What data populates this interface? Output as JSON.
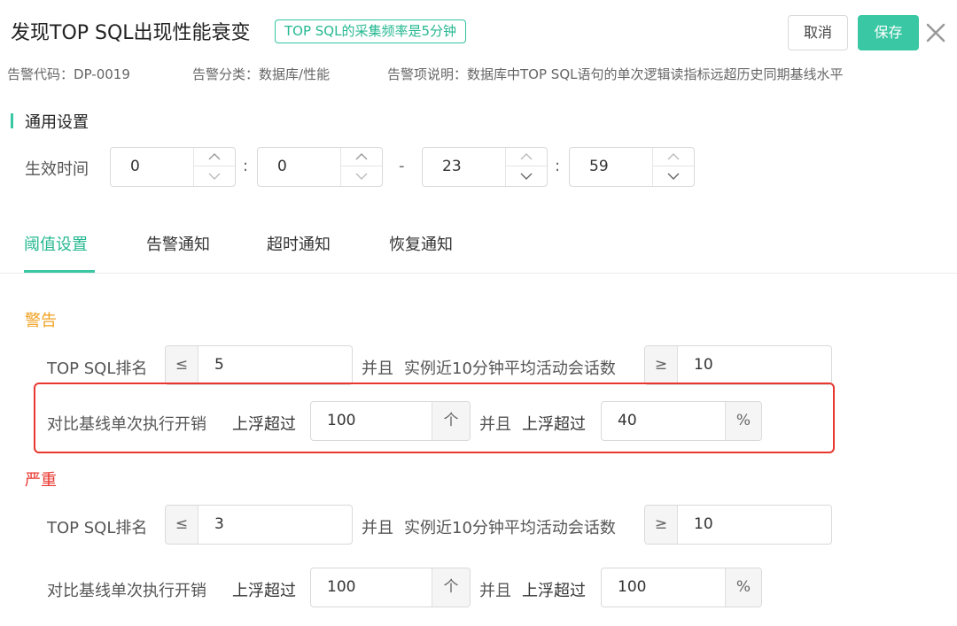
{
  "header": {
    "title": "发现TOP SQL出现性能衰变",
    "badge": "TOP SQL的采集频率是5分钟",
    "cancel_label": "取消",
    "save_label": "保存"
  },
  "meta": {
    "code_label": "告警代码：",
    "code": "DP-0019",
    "category_label": "告警分类：",
    "category": "数据库/性能",
    "desc_label": "告警项说明：",
    "desc": "数据库中TOP SQL语句的单次逻辑读指标远超历史同期基线水平"
  },
  "general": {
    "section_title": "通用设置",
    "effective_time_label": "生效时间",
    "start_hour": "0",
    "start_minute": "0",
    "end_hour": "23",
    "end_minute": "59",
    "colon": ":",
    "dash": "-"
  },
  "tabs": [
    {
      "label": "阈值设置",
      "active": true
    },
    {
      "label": "告警通知",
      "active": false
    },
    {
      "label": "超时通知",
      "active": false
    },
    {
      "label": "恢复通知",
      "active": false
    }
  ],
  "warning": {
    "level_label": "警告",
    "rank_label": "TOP SQL排名",
    "rank_op": "≤",
    "rank_value": "5",
    "and_label": "并且",
    "sessions_label": "实例近10分钟平均活动会话数",
    "sessions_op": "≥",
    "sessions_value": "10",
    "baseline_label": "对比基线单次执行开销",
    "rise_label": "上浮超过",
    "rise_count": "100",
    "rise_count_unit": "个",
    "rise_pct": "40",
    "rise_pct_unit": "%"
  },
  "critical": {
    "level_label": "严重",
    "rank_label": "TOP SQL排名",
    "rank_op": "≤",
    "rank_value": "3",
    "and_label": "并且",
    "sessions_label": "实例近10分钟平均活动会话数",
    "sessions_op": "≥",
    "sessions_value": "10",
    "baseline_label": "对比基线单次执行开销",
    "rise_label": "上浮超过",
    "rise_count": "100",
    "rise_count_unit": "个",
    "rise_pct": "100",
    "rise_pct_unit": "%"
  },
  "colors": {
    "accent": "#3ac7a3",
    "warning": "#f0a020",
    "critical": "#e8372e",
    "highlight": "#e8372e"
  }
}
